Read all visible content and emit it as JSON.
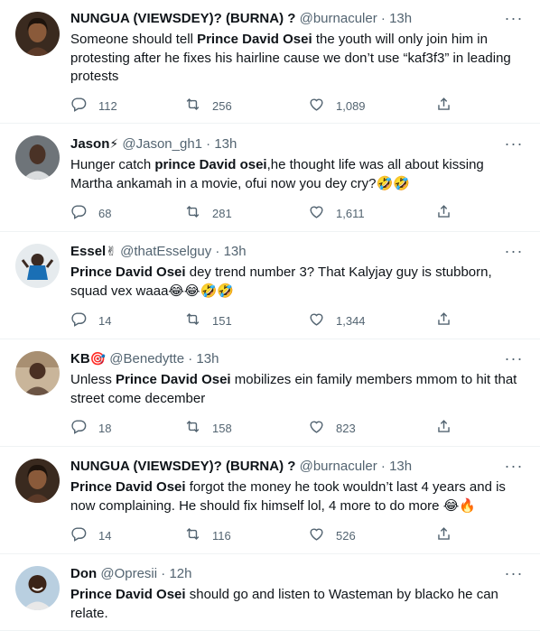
{
  "icons": {
    "reply": "reply-icon",
    "retweet": "retweet-icon",
    "like": "heart-icon",
    "share": "share-icon",
    "more": "more-dots-icon"
  },
  "more_label": "···",
  "tweets": [
    {
      "name": "NUNGUA (VIEWSDEY)? (BURNA) ?",
      "name_emoji": "",
      "handle": "@burnaculer",
      "dot": "·",
      "time": "13h",
      "text_parts": [
        {
          "t": "Someone should tell ",
          "b": false
        },
        {
          "t": "Prince David Osei",
          "b": true
        },
        {
          "t": " the youth will only join him in protesting after he fixes his hairline cause we don’t use “kaf3f3” in leading protests",
          "b": false
        }
      ],
      "replies": "112",
      "retweets": "256",
      "likes": "1,089"
    },
    {
      "name": "Jason",
      "name_emoji": "⚡",
      "handle": "@Jason_gh1",
      "dot": "·",
      "time": "13h",
      "text_parts": [
        {
          "t": "Hunger catch ",
          "b": false
        },
        {
          "t": "prince David osei",
          "b": true
        },
        {
          "t": ",he thought life was all about kissing Martha ankamah in a movie, ofui now you dey cry?🤣🤣",
          "b": false
        }
      ],
      "replies": "68",
      "retweets": "281",
      "likes": "1,611"
    },
    {
      "name": "Essel",
      "name_emoji": "✌",
      "handle": "@thatEsselguy",
      "dot": "·",
      "time": "13h",
      "text_parts": [
        {
          "t": "Prince David Osei",
          "b": true
        },
        {
          "t": " dey trend number 3? That Kalyjay guy is stubborn, squad vex waaa😂😂🤣🤣",
          "b": false
        }
      ],
      "replies": "14",
      "retweets": "151",
      "likes": "1,344"
    },
    {
      "name": "KB",
      "name_emoji": "🎯",
      "handle": "@Benedytte",
      "dot": "·",
      "time": "13h",
      "text_parts": [
        {
          "t": "Unless ",
          "b": false
        },
        {
          "t": "Prince David Osei",
          "b": true
        },
        {
          "t": " mobilizes ein family members mmom to hit that street come december",
          "b": false
        }
      ],
      "replies": "18",
      "retweets": "158",
      "likes": "823"
    },
    {
      "name": "NUNGUA (VIEWSDEY)? (BURNA) ?",
      "name_emoji": "",
      "handle": "@burnaculer",
      "dot": "·",
      "time": "13h",
      "text_parts": [
        {
          "t": "Prince David Osei",
          "b": true
        },
        {
          "t": " forgot the money he took wouldn’t last 4 years and is now complaining. He should fix himself lol, 4 more to do more 😂🔥",
          "b": false
        }
      ],
      "replies": "14",
      "retweets": "116",
      "likes": "526"
    },
    {
      "name": "Don",
      "name_emoji": "",
      "handle": "@Opresii",
      "dot": "·",
      "time": "12h",
      "text_parts": [
        {
          "t": "Prince David Osei",
          "b": true
        },
        {
          "t": " should go and listen to Wasteman by blacko he can relate.",
          "b": false
        }
      ],
      "replies": "",
      "retweets": "",
      "likes": ""
    }
  ]
}
